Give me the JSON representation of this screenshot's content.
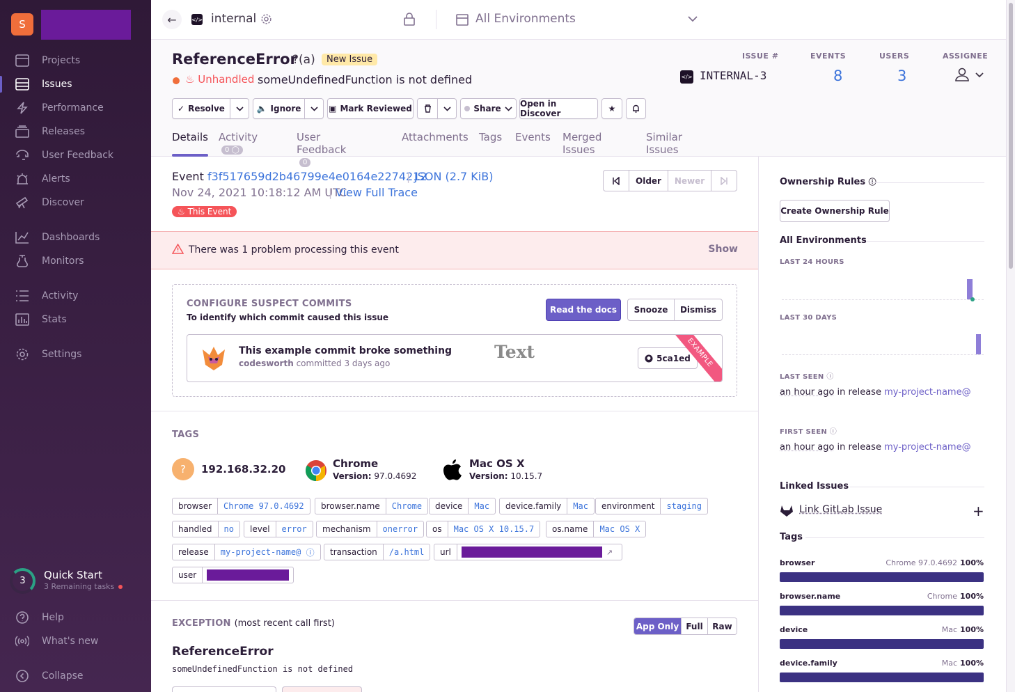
{
  "colors": {
    "accent": "#6c5fc7",
    "link": "#3d74db",
    "error": "#f55459",
    "sidebar_bg": "#2f1937"
  },
  "sidebar": {
    "org_initial": "S",
    "items": [
      {
        "label": "Projects",
        "icon": "projects-icon"
      },
      {
        "label": "Issues",
        "icon": "issues-icon",
        "active": true
      },
      {
        "label": "Performance",
        "icon": "lightning-icon"
      },
      {
        "label": "Releases",
        "icon": "releases-icon"
      },
      {
        "label": "User Feedback",
        "icon": "feedback-icon"
      },
      {
        "label": "Alerts",
        "icon": "siren-icon"
      },
      {
        "label": "Discover",
        "icon": "telescope-icon"
      },
      {
        "label": "Dashboards",
        "icon": "graph-icon"
      },
      {
        "label": "Monitors",
        "icon": "timer-icon"
      },
      {
        "label": "Activity",
        "icon": "list-icon"
      },
      {
        "label": "Stats",
        "icon": "stats-icon"
      },
      {
        "label": "Settings",
        "icon": "gear-icon"
      }
    ],
    "quick_start": {
      "count": "3",
      "title": "Quick Start",
      "subtitle": "3 Remaining tasks"
    },
    "help": "Help",
    "whats_new": "What's new",
    "collapse": "Collapse"
  },
  "topbar": {
    "project": "internal",
    "environment": "All Environments"
  },
  "issue": {
    "title": "ReferenceError",
    "culprit": "?(a)",
    "badge": "New Issue",
    "unhandled": "Unhandled",
    "message": "someUndefinedFunction is not defined",
    "stats": {
      "issue_label": "ISSUE #",
      "issue_id": "INTERNAL-3",
      "events_label": "EVENTS",
      "events": "8",
      "users_label": "USERS",
      "users": "3",
      "assignee_label": "ASSIGNEE"
    }
  },
  "actions": {
    "resolve": "Resolve",
    "ignore": "Ignore",
    "mark_reviewed": "Mark Reviewed",
    "share": "Share",
    "open_discover": "Open in Discover"
  },
  "tabs": [
    {
      "label": "Details"
    },
    {
      "label": "Activity",
      "badge": "0"
    },
    {
      "label": "User Feedback",
      "badge": "0"
    },
    {
      "label": "Attachments"
    },
    {
      "label": "Tags"
    },
    {
      "label": "Events"
    },
    {
      "label": "Merged Issues"
    },
    {
      "label": "Similar Issues"
    }
  ],
  "event": {
    "label": "Event",
    "id": "f3f517659d2b46799e4e0164e2274212",
    "json": "JSON (2.7 KiB)",
    "date": "Nov 24, 2021 10:18:12 AM UTC",
    "full_trace": "View Full Trace",
    "this_event": "This Event",
    "older": "Older",
    "newer": "Newer"
  },
  "problem": {
    "text": "There was 1 problem processing this event",
    "show": "Show"
  },
  "suspect": {
    "title": "CONFIGURE SUSPECT COMMITS",
    "subtitle": "To identify which commit caused this issue",
    "read_docs": "Read the docs",
    "snooze": "Snooze",
    "dismiss": "Dismiss",
    "commit_msg": "This example commit broke something",
    "author": "codesworth",
    "committed": " committed 3 days ago",
    "watermark": "Text",
    "sha": "5ca1ed",
    "ribbon": "EXAMPLE"
  },
  "tags_section": {
    "title": "TAGS",
    "ip": "192.168.32.20",
    "browser": {
      "name": "Chrome",
      "version_label": "Version:",
      "version": "97.0.4692"
    },
    "os": {
      "name": "Mac OS X",
      "version_label": "Version:",
      "version": "10.15.7"
    },
    "pills": [
      {
        "k": "browser",
        "v": "Chrome 97.0.4692"
      },
      {
        "k": "browser.name",
        "v": "Chrome"
      },
      {
        "k": "device",
        "v": "Mac"
      },
      {
        "k": "device.family",
        "v": "Mac"
      },
      {
        "k": "environment",
        "v": "staging"
      },
      {
        "k": "handled",
        "v": "no"
      },
      {
        "k": "level",
        "v": "error"
      },
      {
        "k": "mechanism",
        "v": "onerror"
      },
      {
        "k": "os",
        "v": "Mac OS X 10.15.7"
      },
      {
        "k": "os.name",
        "v": "Mac OS X"
      },
      {
        "k": "release",
        "v": "my-project-name@"
      },
      {
        "k": "transaction",
        "v": "/a.html"
      },
      {
        "k": "url",
        "v": ""
      },
      {
        "k": "user",
        "v": ""
      }
    ]
  },
  "exception": {
    "title": "EXCEPTION",
    "subtitle": "(most recent call first)",
    "app_only": "App Only",
    "full": "Full",
    "raw": "Raw",
    "name": "ReferenceError",
    "message": "someUndefinedFunction is not defined"
  },
  "side": {
    "ownership": "Ownership Rules",
    "create_rule": "Create Ownership Rule",
    "all_env": "All Environments",
    "last24": "LAST 24 HOURS",
    "last30": "LAST 30 DAYS",
    "last_seen": "LAST SEEN",
    "first_seen": "FIRST SEEN",
    "seen_text": "an hour ago",
    "in_release": " in release ",
    "release": "my-project-name@",
    "linked": "Linked Issues",
    "gitlab": "Link GitLab Issue",
    "tags": "Tags",
    "tag_rows": [
      {
        "name": "browser",
        "value": "Chrome 97.0.4692",
        "pct": "100%"
      },
      {
        "name": "browser.name",
        "value": "Chrome",
        "pct": "100%"
      },
      {
        "name": "device",
        "value": "Mac",
        "pct": "100%"
      },
      {
        "name": "device.family",
        "value": "Mac",
        "pct": "100%"
      }
    ]
  }
}
